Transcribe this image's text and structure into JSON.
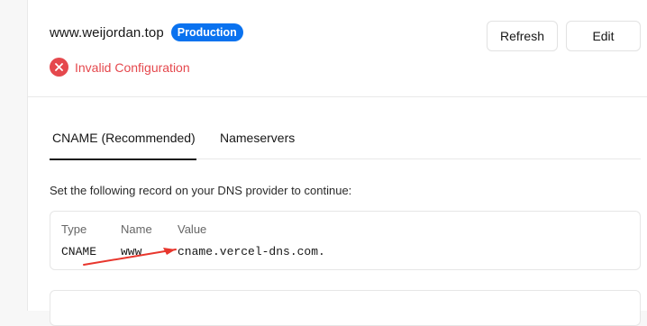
{
  "domain": {
    "name": "www.weijordan.top",
    "badge": "Production",
    "status": "Invalid Configuration"
  },
  "actions": {
    "refresh_label": "Refresh",
    "edit_label": "Edit"
  },
  "tabs": [
    {
      "label": "CNAME (Recommended)",
      "active": true
    },
    {
      "label": "Nameservers",
      "active": false
    }
  ],
  "instructions": "Set the following record on your DNS provider to continue:",
  "record": {
    "headers": {
      "type": "Type",
      "name": "Name",
      "value": "Value"
    },
    "values": {
      "type": "CNAME",
      "name": "www",
      "value": "cname.vercel-dns.com."
    }
  },
  "colors": {
    "accent": "#0a72ef",
    "error": "#e5484d",
    "annotation_arrow": "#e8362d"
  },
  "icons": {
    "status": "error-x-circle-icon",
    "annotation": "red-arrow-annotation"
  }
}
